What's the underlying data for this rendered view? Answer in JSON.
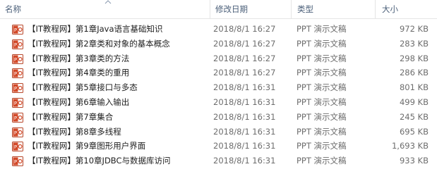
{
  "header": {
    "name_label": "名称",
    "date_label": "修改日期",
    "type_label": "类型",
    "size_label": "大小"
  },
  "files": [
    {
      "name": "【IT教程网】第1章Java语言基础知识",
      "date": "2018/8/1 16:27",
      "type": "PPT 演示文稿",
      "size": "972 KB"
    },
    {
      "name": "【IT教程网】第2章类和对象的基本概念",
      "date": "2018/8/1 16:27",
      "type": "PPT 演示文稿",
      "size": "283 KB"
    },
    {
      "name": "【IT教程网】第3章类的方法",
      "date": "2018/8/1 16:27",
      "type": "PPT 演示文稿",
      "size": "298 KB"
    },
    {
      "name": "【IT教程网】第4章类的重用",
      "date": "2018/8/1 16:27",
      "type": "PPT 演示文稿",
      "size": "286 KB"
    },
    {
      "name": "【IT教程网】第5章接口与多态",
      "date": "2018/8/1 16:31",
      "type": "PPT 演示文稿",
      "size": "801 KB"
    },
    {
      "name": "【IT教程网】第6章输入输出",
      "date": "2018/8/1 16:31",
      "type": "PPT 演示文稿",
      "size": "499 KB"
    },
    {
      "name": "【IT教程网】第7章集合",
      "date": "2018/8/1 16:31",
      "type": "PPT 演示文稿",
      "size": "245 KB"
    },
    {
      "name": "【IT教程网】第8章多线程",
      "date": "2018/8/1 16:31",
      "type": "PPT 演示文稿",
      "size": "695 KB"
    },
    {
      "name": "【IT教程网】第9章图形用户界面",
      "date": "2018/8/1 16:31",
      "type": "PPT 演示文稿",
      "size": "1,693 KB"
    },
    {
      "name": "【IT教程网】第10章JDBC与数据库访问",
      "date": "2018/8/1 16:31",
      "type": "PPT 演示文稿",
      "size": "933 KB"
    }
  ],
  "icons": {
    "file_icon": "ppt-file-icon",
    "sort_icon": "sort-ascending-icon"
  },
  "colors": {
    "header_text": "#4c607a",
    "ppt_icon": "#d24726"
  }
}
